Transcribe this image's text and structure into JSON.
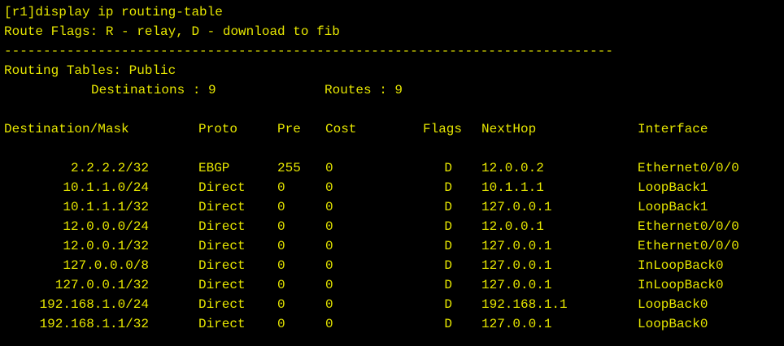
{
  "terminal": {
    "text_color": "#e6e600",
    "background_color": "#000000",
    "command": "[r1]display ip routing-table",
    "flags_legend": "Route Flags: R - relay, D - download to fib",
    "separator": "------------------------------------------------------------------------------",
    "table_name": "Routing Tables: Public",
    "destinations_label": "Destinations : 9",
    "routes_label": "Routes : 9"
  },
  "routes": {
    "columns": {
      "destination": "Destination/Mask",
      "proto": "Proto",
      "pre": "Pre",
      "cost": "Cost",
      "flags": "Flags",
      "nexthop": "NextHop",
      "interface": "Interface"
    },
    "rows": [
      {
        "destination": "2.2.2.2/32",
        "proto": "EBGP",
        "pre": "255",
        "cost": "0",
        "flags": "D",
        "nexthop": "12.0.0.2",
        "interface": "Ethernet0/0/0"
      },
      {
        "destination": "10.1.1.0/24",
        "proto": "Direct",
        "pre": "0",
        "cost": "0",
        "flags": "D",
        "nexthop": "10.1.1.1",
        "interface": "LoopBack1"
      },
      {
        "destination": "10.1.1.1/32",
        "proto": "Direct",
        "pre": "0",
        "cost": "0",
        "flags": "D",
        "nexthop": "127.0.0.1",
        "interface": "LoopBack1"
      },
      {
        "destination": "12.0.0.0/24",
        "proto": "Direct",
        "pre": "0",
        "cost": "0",
        "flags": "D",
        "nexthop": "12.0.0.1",
        "interface": "Ethernet0/0/0"
      },
      {
        "destination": "12.0.0.1/32",
        "proto": "Direct",
        "pre": "0",
        "cost": "0",
        "flags": "D",
        "nexthop": "127.0.0.1",
        "interface": "Ethernet0/0/0"
      },
      {
        "destination": "127.0.0.0/8",
        "proto": "Direct",
        "pre": "0",
        "cost": "0",
        "flags": "D",
        "nexthop": "127.0.0.1",
        "interface": "InLoopBack0"
      },
      {
        "destination": "127.0.0.1/32",
        "proto": "Direct",
        "pre": "0",
        "cost": "0",
        "flags": "D",
        "nexthop": "127.0.0.1",
        "interface": "InLoopBack0"
      },
      {
        "destination": "192.168.1.0/24",
        "proto": "Direct",
        "pre": "0",
        "cost": "0",
        "flags": "D",
        "nexthop": "192.168.1.1",
        "interface": "LoopBack0"
      },
      {
        "destination": "192.168.1.1/32",
        "proto": "Direct",
        "pre": "0",
        "cost": "0",
        "flags": "D",
        "nexthop": "127.0.0.1",
        "interface": "LoopBack0"
      }
    ]
  }
}
